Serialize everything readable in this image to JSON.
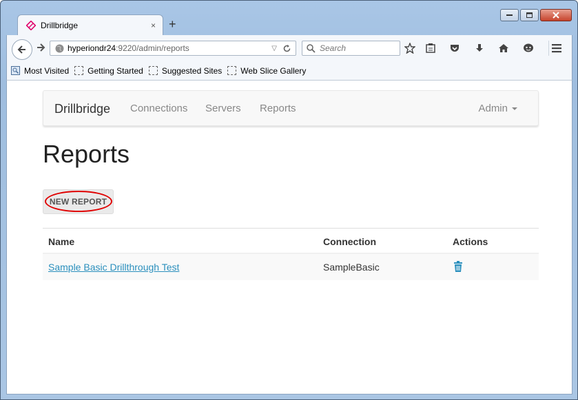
{
  "browser": {
    "tab_title": "Drillbridge",
    "tab_close": "×",
    "new_tab": "+",
    "url_host": "hyperiondr24",
    "url_rest": ":9220/admin/reports",
    "search_placeholder": "Search",
    "bookmarks": [
      "Most Visited",
      "Getting Started",
      "Suggested Sites",
      "Web Slice Gallery"
    ]
  },
  "app": {
    "brand": "Drillbridge",
    "nav": [
      "Connections",
      "Servers",
      "Reports"
    ],
    "admin": "Admin"
  },
  "page": {
    "title": "Reports",
    "new_report_label": "NEW REPORT"
  },
  "table": {
    "headers": [
      "Name",
      "Connection",
      "Actions"
    ],
    "rows": [
      {
        "name": "Sample Basic Drillthrough Test",
        "connection": "SampleBasic",
        "action_icon": "trash-icon"
      }
    ]
  },
  "colors": {
    "link": "#2a8fbd",
    "annotation": "#e00000"
  }
}
